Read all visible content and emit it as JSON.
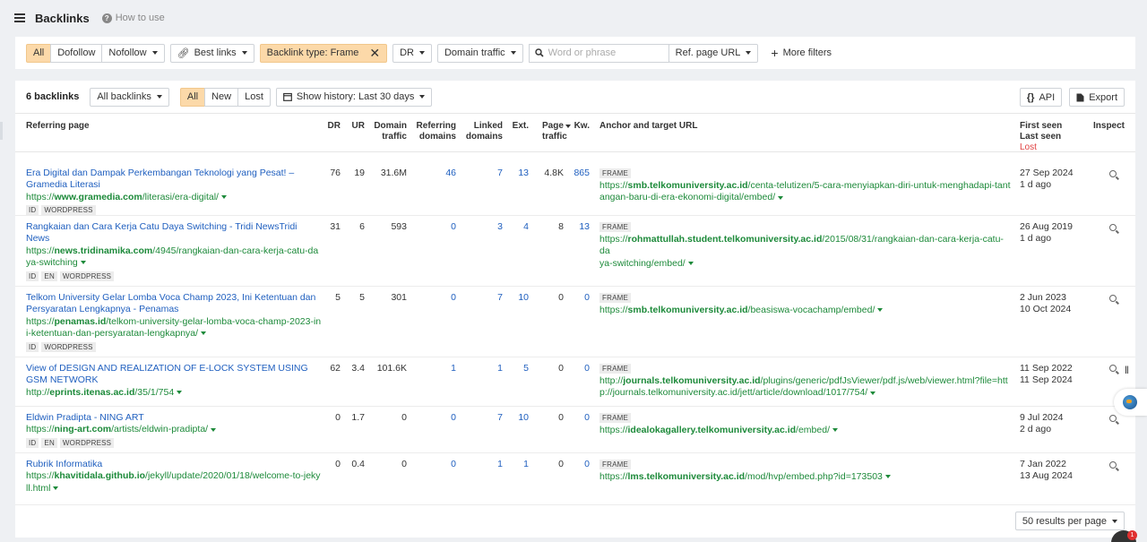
{
  "header": {
    "title": "Backlinks",
    "how_to_use": "How to use"
  },
  "filters": {
    "link_types": [
      "All",
      "Dofollow",
      "Nofollow"
    ],
    "best_links": "Best links",
    "backlink_type": "Backlink type: Frame",
    "dr": "DR",
    "domain_traffic": "Domain traffic",
    "search_placeholder": "Word or phrase",
    "ref_page_url": "Ref. page URL",
    "more_filters": "More filters"
  },
  "panel": {
    "count": "6 backlinks",
    "all_backlinks": "All backlinks",
    "history_tabs": [
      "All",
      "New",
      "Lost"
    ],
    "show_history": "Show history: Last 30 days",
    "api": "API",
    "export": "Export"
  },
  "columns": {
    "referring_page": "Referring page",
    "dr": "DR",
    "ur": "UR",
    "domain_traffic": [
      "Domain",
      "traffic"
    ],
    "referring_domains": [
      "Referring",
      "domains"
    ],
    "linked_domains": [
      "Linked",
      "domains"
    ],
    "ext": "Ext.",
    "page_traffic": [
      "Page",
      "traffic"
    ],
    "kw": "Kw.",
    "anchor": "Anchor and target URL",
    "first_seen": "First seen",
    "last_seen": "Last seen",
    "lost": "Lost",
    "inspect": "Inspect"
  },
  "rows": [
    {
      "title": [
        "Era Digital dan Dampak Perkembangan Teknologi yang Pesat! –",
        "Gramedia Literasi"
      ],
      "url": [
        {
          "pre": "https://",
          "domain": "www.gramedia.com",
          "path": "/literasi/era-digital/",
          "caret": true
        }
      ],
      "tags": [
        "ID",
        "WORDPRESS"
      ],
      "dr": "76",
      "ur": "19",
      "domain_traffic": "31.6M",
      "ref_domains": "46",
      "linked_domains": "7",
      "ext": "13",
      "page_traffic": "4.8K",
      "kw": "865",
      "anchor_tag": "FRAME",
      "target": [
        {
          "pre": "https://",
          "domain": "smb.telkomuniversity.ac.id",
          "path": "/centa-telutizen/5-cara-menyiapkan-diri-untuk-menghadapi-tant"
        },
        {
          "pre": "",
          "domain": "",
          "path": "angan-baru-di-era-ekonomi-digital/embed/",
          "caret": true
        }
      ],
      "first_seen": "27 Sep 2024",
      "last_seen": "1 d ago"
    },
    {
      "title": [
        "Rangkaian dan Cara Kerja Catu Daya Switching - Tridi NewsTridi",
        "News"
      ],
      "url": [
        {
          "pre": "https://",
          "domain": "news.tridinamika.com",
          "path": "/4945/rangkaian-dan-cara-kerja-catu-da"
        },
        {
          "pre": "",
          "domain": "",
          "path": "ya-switching",
          "caret": true
        }
      ],
      "tags": [
        "ID",
        "EN",
        "WORDPRESS"
      ],
      "dr": "31",
      "ur": "6",
      "domain_traffic": "593",
      "ref_domains": "0",
      "linked_domains": "3",
      "ext": "4",
      "page_traffic": "8",
      "kw": "13",
      "anchor_tag": "FRAME",
      "target": [
        {
          "pre": "https://",
          "domain": "rohmattullah.student.telkomuniversity.ac.id",
          "path": "/2015/08/31/rangkaian-dan-cara-kerja-catu-da"
        },
        {
          "pre": "",
          "domain": "",
          "path": "ya-switching/embed/",
          "caret": true
        }
      ],
      "first_seen": "26 Aug 2019",
      "last_seen": "1 d ago"
    },
    {
      "title": [
        "Telkom University Gelar Lomba Voca Champ 2023, Ini Ketentuan dan",
        "Persyaratan Lengkapnya - Penamas"
      ],
      "url": [
        {
          "pre": "https://",
          "domain": "penamas.id",
          "path": "/telkom-university-gelar-lomba-voca-champ-2023-in"
        },
        {
          "pre": "",
          "domain": "",
          "path": "i-ketentuan-dan-persyaratan-lengkapnya/",
          "caret": true
        }
      ],
      "tags": [
        "ID",
        "WORDPRESS"
      ],
      "dr": "5",
      "ur": "5",
      "domain_traffic": "301",
      "ref_domains": "0",
      "linked_domains": "7",
      "ext": "10",
      "page_traffic": "0",
      "kw": "0",
      "anchor_tag": "FRAME",
      "target": [
        {
          "pre": "https://",
          "domain": "smb.telkomuniversity.ac.id",
          "path": "/beasiswa-vocachamp/embed/",
          "caret": true
        }
      ],
      "first_seen": "2 Jun 2023",
      "last_seen": "10 Oct 2024"
    },
    {
      "title": [
        "View of DESIGN AND REALIZATION OF E-LOCK SYSTEM USING",
        "GSM NETWORK"
      ],
      "url": [
        {
          "pre": "http://",
          "domain": "eprints.itenas.ac.id",
          "path": "/35/1/754",
          "caret": true
        }
      ],
      "tags": [],
      "dr": "62",
      "ur": "3.4",
      "domain_traffic": "101.6K",
      "ref_domains": "1",
      "linked_domains": "1",
      "ext": "5",
      "page_traffic": "0",
      "kw": "0",
      "anchor_tag": "FRAME",
      "target": [
        {
          "pre": "http://",
          "domain": "journals.telkomuniversity.ac.id",
          "path": "/plugins/generic/pdfJsViewer/pdf.js/web/viewer.html?file=htt"
        },
        {
          "pre": "",
          "domain": "",
          "path": "p://journals.telkomuniversity.ac.id/jett/article/download/1017/754/",
          "caret": true
        }
      ],
      "first_seen": "11 Sep 2022",
      "last_seen": "11 Sep 2024"
    },
    {
      "title": [
        "Eldwin Pradipta - NING ART"
      ],
      "url": [
        {
          "pre": "https://",
          "domain": "ning-art.com",
          "path": "/artists/eldwin-pradipta/",
          "caret": true
        }
      ],
      "tags": [
        "ID",
        "EN",
        "WORDPRESS"
      ],
      "dr": "0",
      "ur": "1.7",
      "domain_traffic": "0",
      "ref_domains": "0",
      "linked_domains": "7",
      "ext": "10",
      "page_traffic": "0",
      "kw": "0",
      "anchor_tag": "FRAME",
      "target": [
        {
          "pre": "https://",
          "domain": "idealokagallery.telkomuniversity.ac.id",
          "path": "/embed/",
          "caret": true
        }
      ],
      "first_seen": "9 Jul 2024",
      "last_seen": "2 d ago"
    },
    {
      "title": [
        "Rubrik Informatika"
      ],
      "url": [
        {
          "pre": "https://",
          "domain": "khavitidala.github.io",
          "path": "/jekyll/update/2020/01/18/welcome-to-jeky"
        },
        {
          "pre": "",
          "domain": "",
          "path": "ll.html",
          "caret": true
        }
      ],
      "tags": [],
      "dr": "0",
      "ur": "0.4",
      "domain_traffic": "0",
      "ref_domains": "0",
      "linked_domains": "1",
      "ext": "1",
      "page_traffic": "0",
      "kw": "0",
      "anchor_tag": "FRAME",
      "target": [
        {
          "pre": "https://",
          "domain": "lms.telkomuniversity.ac.id",
          "path": "/mod/hvp/embed.php?id=173503",
          "caret": true
        }
      ],
      "first_seen": "7 Jan 2022",
      "last_seen": "13 Aug 2024"
    }
  ],
  "per_page": "50 results per page",
  "notification_count": "1"
}
